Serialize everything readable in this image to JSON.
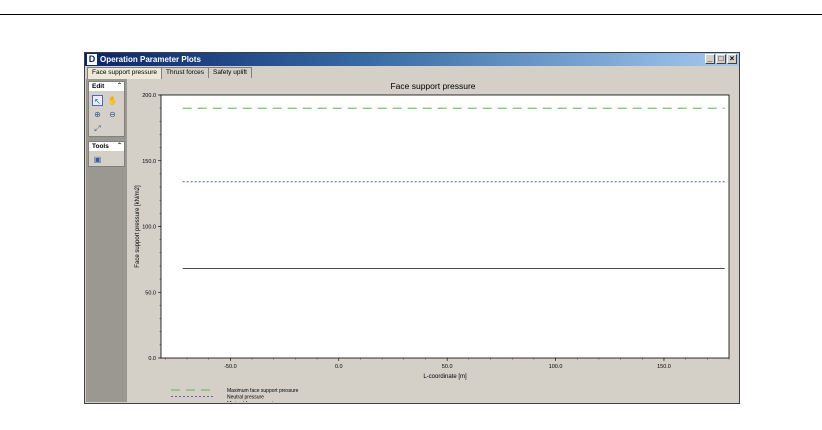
{
  "window": {
    "title": "Operation Parameter Plots",
    "controls": [
      "_",
      "□",
      "×"
    ]
  },
  "tabs": [
    {
      "label": "Face support pressure",
      "active": true
    },
    {
      "label": "Thrust forces",
      "active": false
    },
    {
      "label": "Safety uplift",
      "active": false
    }
  ],
  "sidebar": {
    "edit_label": "Edit",
    "tools_label": "Tools",
    "collapse_glyph": "⌃",
    "edit_tools": [
      "pointer-icon",
      "hand-icon",
      "zoom-in-icon",
      "zoom-out-icon",
      "zoom-fit-icon"
    ],
    "tools_tools": [
      "save-image-icon"
    ]
  },
  "chart_data": {
    "type": "line",
    "title": "Face support pressure",
    "xlabel": "L-coordinate [m]",
    "ylabel": "Face support pressure [kN/m2]",
    "xlim": [
      -82,
      180
    ],
    "ylim": [
      0,
      200
    ],
    "x_ticks": [
      "-50.0",
      "0.0",
      "50.0",
      "100.0",
      "150.0"
    ],
    "y_ticks": [
      "0.0",
      "50.0",
      "100.0",
      "150.0",
      "200.0"
    ],
    "series": [
      {
        "name": "Maximum face support pressure",
        "x": [
          -72,
          178
        ],
        "values": [
          190,
          190
        ],
        "color": "#3aaa3a",
        "dash": "9,6"
      },
      {
        "name": "Neutral pressure",
        "x": [
          -72,
          178
        ],
        "values": [
          134,
          134
        ],
        "color": "#3c3ca8",
        "dash": "2,2"
      },
      {
        "name": "Minimal face support pressure",
        "x": [
          -72,
          178
        ],
        "values": [
          68,
          68
        ],
        "color": "#303030",
        "dash": ""
      }
    ]
  }
}
